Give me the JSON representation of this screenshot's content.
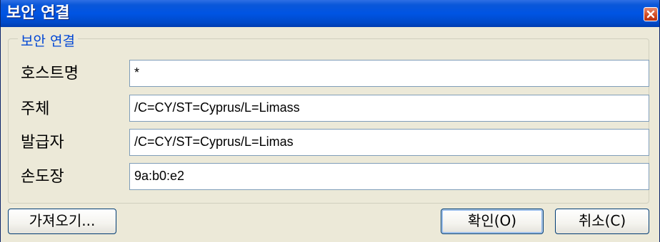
{
  "window": {
    "title": "보안 연결"
  },
  "group": {
    "title": "보안 연결"
  },
  "fields": [
    {
      "label": "호스트명",
      "value": "*"
    },
    {
      "label": "주체",
      "value": "/C=CY/ST=Cyprus/L=Limass"
    },
    {
      "label": "발급자",
      "value": "/C=CY/ST=Cyprus/L=Limas"
    },
    {
      "label": "손도장",
      "value": "9a:b0:e2"
    }
  ],
  "buttons": {
    "import_label": "가져오기...",
    "ok_label": "확인(O)",
    "cancel_label": "취소(C)"
  },
  "colors": {
    "titlebar": "#0054e3",
    "group_title": "#0046d5",
    "close_button": "#d0481f"
  },
  "icons": {
    "close": "close-icon"
  }
}
